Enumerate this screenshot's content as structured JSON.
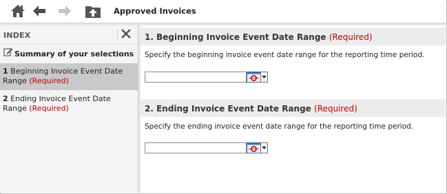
{
  "toolbar": {
    "title": "Approved Invoices",
    "home_icon": "home-icon",
    "back_icon": "arrow-left-icon",
    "forward_icon": "arrow-right-icon",
    "up_icon": "folder-up-icon"
  },
  "sidebar": {
    "header": "INDEX",
    "close_icon": "close-icon",
    "summary_label": "Summary of your selections",
    "summary_icon": "edit-icon",
    "items": [
      {
        "number": "1",
        "label": "Beginning Invoice Event Date Range",
        "required": "(Required)",
        "active": true
      },
      {
        "number": "2",
        "label": "Ending Invoice Event Date Range",
        "required": "(Required)",
        "active": false
      }
    ]
  },
  "sections": [
    {
      "number": "1.",
      "title": "Beginning Invoice Event Date Range",
      "required": "(Required)",
      "description": "Specify the beginning invoice event date range for the reporting time period.",
      "input_value": "",
      "picker_icon": "calendar-icon"
    },
    {
      "number": "2.",
      "title": "Ending Invoice Event Date Range",
      "required": "(Required)",
      "description": "Specify the ending invoice event date range for the reporting time period.",
      "input_value": "",
      "picker_icon": "calendar-icon"
    }
  ],
  "colors": {
    "required": "#c00000",
    "icon_gray": "#555555",
    "calendar_red": "#cc0000",
    "calendar_blue": "#3a6fb5"
  }
}
